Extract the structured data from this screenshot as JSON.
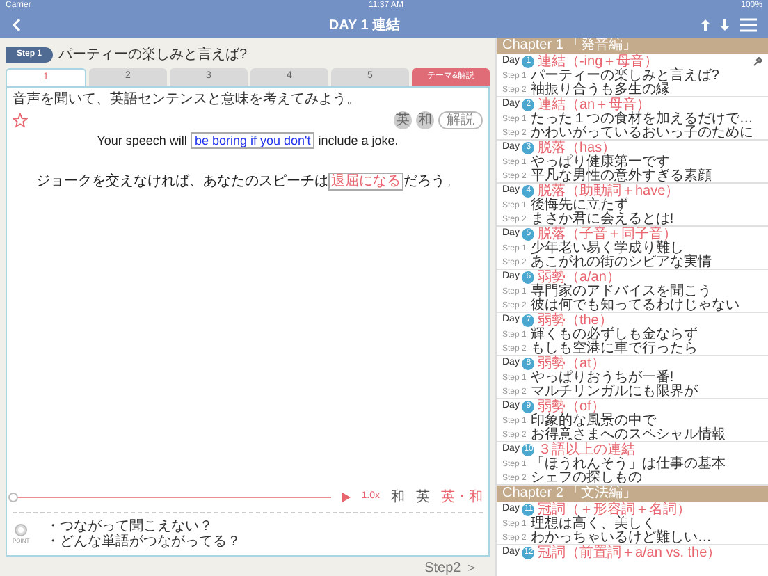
{
  "status_bar": {
    "carrier": "Carrier",
    "time": "11:37 AM",
    "battery": "100%"
  },
  "nav": {
    "title": "DAY 1 連結"
  },
  "step": {
    "badge": "Step 1",
    "title": "パーティーの楽しみと言えば?"
  },
  "tabs": [
    {
      "label": "1",
      "kind": "number",
      "selected": true
    },
    {
      "label": "2",
      "kind": "number",
      "selected": false
    },
    {
      "label": "3",
      "kind": "number",
      "selected": false
    },
    {
      "label": "4",
      "kind": "number",
      "selected": false
    },
    {
      "label": "5",
      "kind": "number",
      "selected": false
    },
    {
      "label": "テーマ&解説",
      "kind": "theme",
      "selected": false
    }
  ],
  "instruction": "音声を聞いて、英語センテンスと意味を考えてみよう。",
  "favorite": false,
  "view_buttons": [
    {
      "label": "英",
      "kind": "circle"
    },
    {
      "label": "和",
      "kind": "circle"
    },
    {
      "label": "解説",
      "kind": "pill"
    }
  ],
  "english": {
    "before": "Your speech will",
    "blank": "be boring if you don't",
    "after": "include a joke."
  },
  "japanese": {
    "before": "ジョークを交えなければ、あなたのスピーチは",
    "blank": "退屈になる",
    "after": "だろう。"
  },
  "player": {
    "level": 0,
    "speed": "1.0x",
    "modes": [
      {
        "label": "和",
        "selected": false
      },
      {
        "label": "英",
        "selected": false
      },
      {
        "label": "英・和",
        "selected": true
      }
    ]
  },
  "point": {
    "label": "POINT",
    "lines": [
      "・つながって聞こえない？",
      "・どんな単語がつながってる？"
    ]
  },
  "next": "Step2 ＞",
  "sidebar": [
    {
      "chapter": "Chapter 1 「発音編」",
      "days": [
        {
          "day": "Day",
          "num": "1",
          "title": "連結（-ing＋母音）",
          "pinned": true,
          "steps": [
            {
              "label": "Step 1",
              "text": "パーティーの楽しみと言えば?"
            },
            {
              "label": "Step 2",
              "text": "袖振り合うも多生の縁"
            }
          ]
        },
        {
          "day": "Day",
          "num": "2",
          "title": "連結（an＋母音）",
          "pinned": false,
          "steps": [
            {
              "label": "Step 1",
              "text": "たった１つの食材を加えるだけで…"
            },
            {
              "label": "Step 2",
              "text": "かわいがっているおいっ子のために"
            }
          ]
        },
        {
          "day": "Day",
          "num": "3",
          "title": "脱落（has）",
          "pinned": false,
          "steps": [
            {
              "label": "Step 1",
              "text": "やっぱり健康第一です"
            },
            {
              "label": "Step 2",
              "text": "平凡な男性の意外すぎる素顔"
            }
          ]
        },
        {
          "day": "Day",
          "num": "4",
          "title": "脱落（助動詞＋have）",
          "pinned": false,
          "steps": [
            {
              "label": "Step 1",
              "text": "後悔先に立たず"
            },
            {
              "label": "Step 2",
              "text": "まさか君に会えるとは!"
            }
          ]
        },
        {
          "day": "Day",
          "num": "5",
          "title": "脱落（子音＋同子音）",
          "pinned": false,
          "steps": [
            {
              "label": "Step 1",
              "text": "少年老い易く学成り難し"
            },
            {
              "label": "Step 2",
              "text": "あこがれの街のシビアな実情"
            }
          ]
        },
        {
          "day": "Day",
          "num": "6",
          "title": "弱勢（a/an）",
          "pinned": false,
          "steps": [
            {
              "label": "Step 1",
              "text": "専門家のアドバイスを聞こう"
            },
            {
              "label": "Step 2",
              "text": "彼は何でも知ってるわけじゃない"
            }
          ]
        },
        {
          "day": "Day",
          "num": "7",
          "title": "弱勢（the）",
          "pinned": false,
          "steps": [
            {
              "label": "Step 1",
              "text": "輝くもの必ずしも金ならず"
            },
            {
              "label": "Step 2",
              "text": "もしも空港に車で行ったら"
            }
          ]
        },
        {
          "day": "Day",
          "num": "8",
          "title": "弱勢（at）",
          "pinned": false,
          "steps": [
            {
              "label": "Step 1",
              "text": "やっぱりおうちが一番!"
            },
            {
              "label": "Step 2",
              "text": "マルチリンガルにも限界が"
            }
          ]
        },
        {
          "day": "Day",
          "num": "9",
          "title": "弱勢（of）",
          "pinned": false,
          "steps": [
            {
              "label": "Step 1",
              "text": "印象的な風景の中で"
            },
            {
              "label": "Step 2",
              "text": "お得意さまへのスペシャル情報"
            }
          ]
        },
        {
          "day": "Day",
          "num": "10",
          "title": "３語以上の連結",
          "pinned": false,
          "steps": [
            {
              "label": "Step 1",
              "text": "「ほうれんそう」は仕事の基本"
            },
            {
              "label": "Step 2",
              "text": "シェフの探しもの"
            }
          ]
        }
      ]
    },
    {
      "chapter": "Chapter 2 「文法編」",
      "days": [
        {
          "day": "Day",
          "num": "11",
          "title": "冠詞（＋形容詞＋名詞）",
          "pinned": false,
          "steps": [
            {
              "label": "Step 1",
              "text": "理想は高く、美しく"
            },
            {
              "label": "Step 2",
              "text": "わかっちゃいるけど難しい…"
            }
          ]
        },
        {
          "day": "Day",
          "num": "12",
          "title": "冠詞（前置詞＋a/an vs. the）",
          "pinned": false
        }
      ]
    }
  ]
}
